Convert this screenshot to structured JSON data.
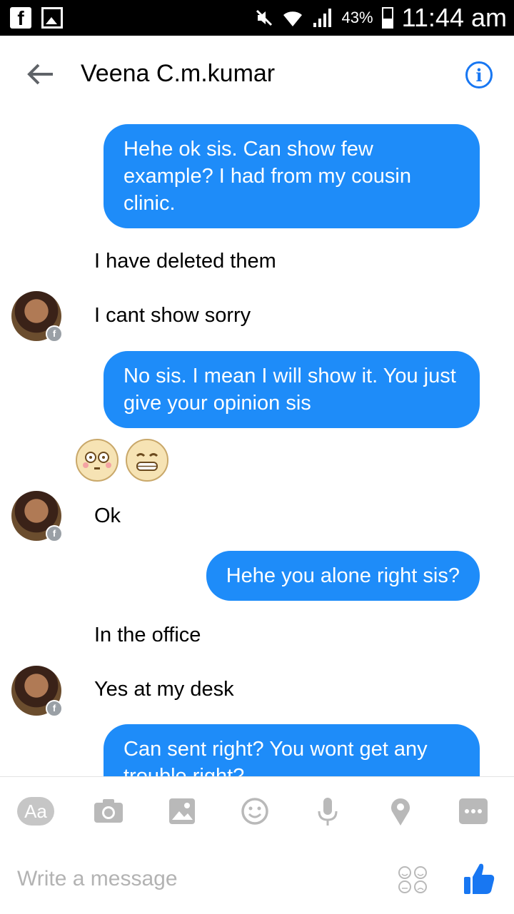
{
  "status_bar": {
    "battery": "43%",
    "time": "11:44 am",
    "left_icons": [
      "facebook-icon",
      "image-icon"
    ],
    "right_icons": [
      "mute-icon",
      "wifi-icon",
      "signal-icon",
      "battery-icon"
    ]
  },
  "header": {
    "title": "Veena C.m.kumar",
    "back_icon": "back-arrow-icon",
    "info_icon": "info-icon"
  },
  "messages": [
    {
      "id": "m1",
      "direction": "sent",
      "text": "Hehe ok sis. Can show few example? I had from my cousin clinic."
    },
    {
      "id": "m2",
      "direction": "received",
      "text": "I have deleted them"
    },
    {
      "id": "m3",
      "direction": "received",
      "text": "I cant show sorry"
    },
    {
      "id": "m4",
      "direction": "sent",
      "text": "No sis. I mean I will show it. You just give your opinion sis"
    },
    {
      "id": "m5",
      "direction": "sent",
      "type": "emoji",
      "emojis": [
        "flushed-face-emoji",
        "grimacing-face-emoji"
      ]
    },
    {
      "id": "m6",
      "direction": "received",
      "text": "Ok"
    },
    {
      "id": "m7",
      "direction": "sent",
      "text": "Hehe you alone right sis?"
    },
    {
      "id": "m8",
      "direction": "received",
      "text": "In the office"
    },
    {
      "id": "m9",
      "direction": "received",
      "text": "Yes at my desk"
    },
    {
      "id": "m10",
      "direction": "sent",
      "text": "Can sent right? You wont get any trouble right?"
    }
  ],
  "composer": {
    "tools": [
      {
        "name": "text-format-button",
        "label": "Aa"
      },
      {
        "name": "camera-icon"
      },
      {
        "name": "gallery-icon"
      },
      {
        "name": "emoji-icon"
      },
      {
        "name": "microphone-icon"
      },
      {
        "name": "location-icon"
      },
      {
        "name": "more-icon"
      }
    ],
    "placeholder": "Write a message",
    "sticker_icon": "sticker-icon",
    "like_icon": "thumbs-up-icon"
  },
  "colors": {
    "accent": "#1e8cf9",
    "header_icon": "#1877f2",
    "tool_icon": "#b9b9b9"
  }
}
